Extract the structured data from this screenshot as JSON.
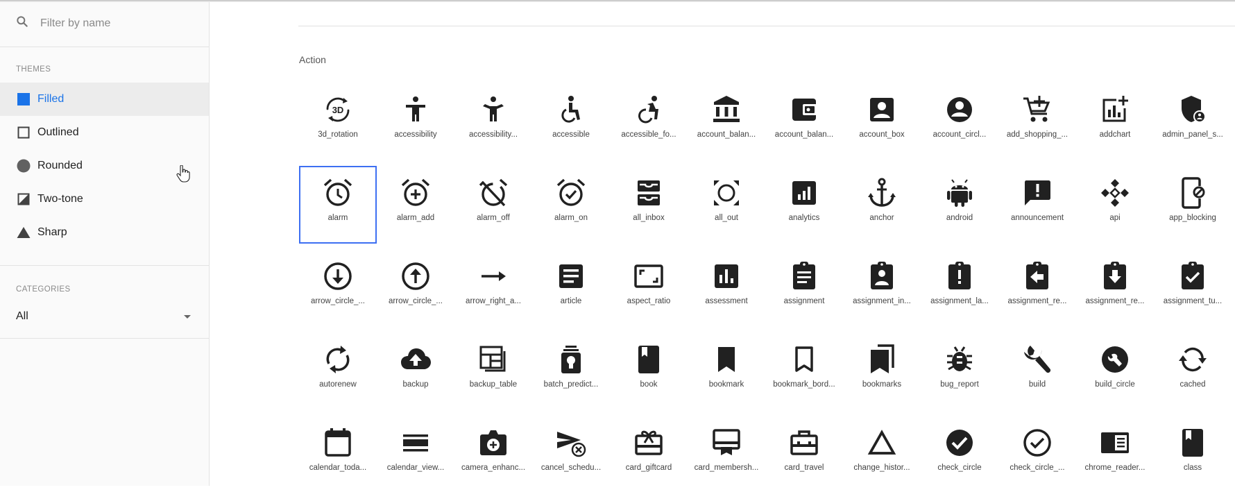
{
  "search": {
    "placeholder": "Filter by name"
  },
  "themes": {
    "heading": "THEMES",
    "items": [
      {
        "label": "Filled",
        "icon": "filled-square-icon"
      },
      {
        "label": "Outlined",
        "icon": "outlined-square-icon"
      },
      {
        "label": "Rounded",
        "icon": "circle-icon"
      },
      {
        "label": "Two-tone",
        "icon": "two-tone-icon"
      },
      {
        "label": "Sharp",
        "icon": "triangle-icon"
      }
    ],
    "active": "Filled"
  },
  "categories": {
    "heading": "CATEGORIES",
    "selected": "All"
  },
  "section": {
    "title": "Action"
  },
  "colors": {
    "accent": "#1a73e8",
    "selection": "#3d6ff2",
    "icon": "#212121"
  },
  "icons": [
    {
      "label": "3d_rotation"
    },
    {
      "label": "accessibility"
    },
    {
      "label": "accessibility..."
    },
    {
      "label": "accessible"
    },
    {
      "label": "accessible_fo..."
    },
    {
      "label": "account_balan..."
    },
    {
      "label": "account_balan..."
    },
    {
      "label": "account_box"
    },
    {
      "label": "account_circl..."
    },
    {
      "label": "add_shopping_..."
    },
    {
      "label": "addchart"
    },
    {
      "label": "admin_panel_s..."
    },
    {
      "label": "alarm"
    },
    {
      "label": "alarm_add"
    },
    {
      "label": "alarm_off"
    },
    {
      "label": "alarm_on"
    },
    {
      "label": "all_inbox"
    },
    {
      "label": "all_out"
    },
    {
      "label": "analytics"
    },
    {
      "label": "anchor"
    },
    {
      "label": "android"
    },
    {
      "label": "announcement"
    },
    {
      "label": "api"
    },
    {
      "label": "app_blocking"
    },
    {
      "label": "arrow_circle_..."
    },
    {
      "label": "arrow_circle_..."
    },
    {
      "label": "arrow_right_a..."
    },
    {
      "label": "article"
    },
    {
      "label": "aspect_ratio"
    },
    {
      "label": "assessment"
    },
    {
      "label": "assignment"
    },
    {
      "label": "assignment_in..."
    },
    {
      "label": "assignment_la..."
    },
    {
      "label": "assignment_re..."
    },
    {
      "label": "assignment_re..."
    },
    {
      "label": "assignment_tu..."
    },
    {
      "label": "autorenew"
    },
    {
      "label": "backup"
    },
    {
      "label": "backup_table"
    },
    {
      "label": "batch_predict..."
    },
    {
      "label": "book"
    },
    {
      "label": "bookmark"
    },
    {
      "label": "bookmark_bord..."
    },
    {
      "label": "bookmarks"
    },
    {
      "label": "bug_report"
    },
    {
      "label": "build"
    },
    {
      "label": "build_circle"
    },
    {
      "label": "cached"
    },
    {
      "label": "calendar_toda..."
    },
    {
      "label": "calendar_view..."
    },
    {
      "label": "camera_enhanc..."
    },
    {
      "label": "cancel_schedu..."
    },
    {
      "label": "card_giftcard"
    },
    {
      "label": "card_membersh..."
    },
    {
      "label": "card_travel"
    },
    {
      "label": "change_histor..."
    },
    {
      "label": "check_circle"
    },
    {
      "label": "check_circle_..."
    },
    {
      "label": "chrome_reader..."
    },
    {
      "label": "class"
    }
  ],
  "selected_icon": "alarm"
}
